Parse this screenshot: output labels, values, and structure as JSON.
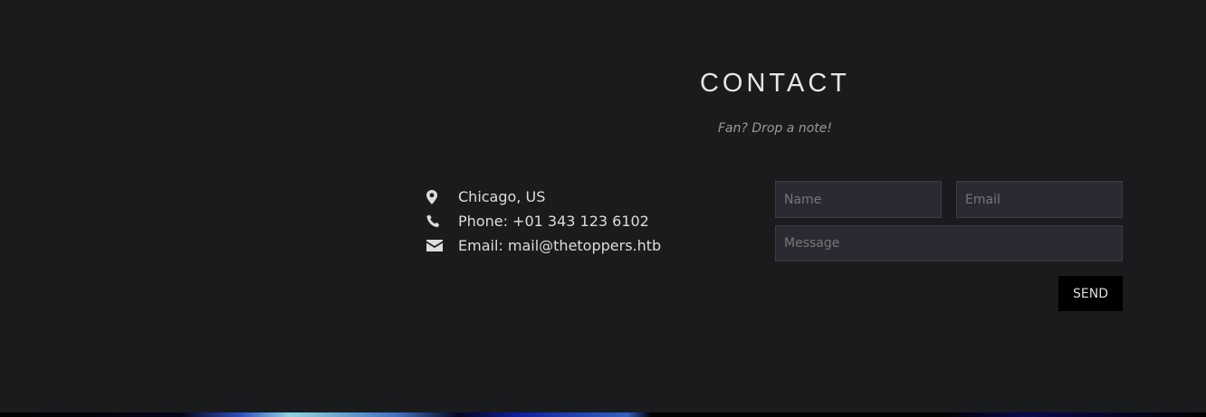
{
  "section": {
    "title": "CONTACT",
    "subtitle": "Fan? Drop a note!"
  },
  "contact_info": [
    {
      "icon": "map-marker-icon",
      "text": "Chicago, US"
    },
    {
      "icon": "phone-icon",
      "text": "Phone: +01 343 123 6102"
    },
    {
      "icon": "envelope-icon",
      "text": "Email: mail@thetoppers.htb"
    }
  ],
  "form": {
    "name_placeholder": "Name",
    "email_placeholder": "Email",
    "message_placeholder": "Message",
    "send_label": "SEND"
  }
}
